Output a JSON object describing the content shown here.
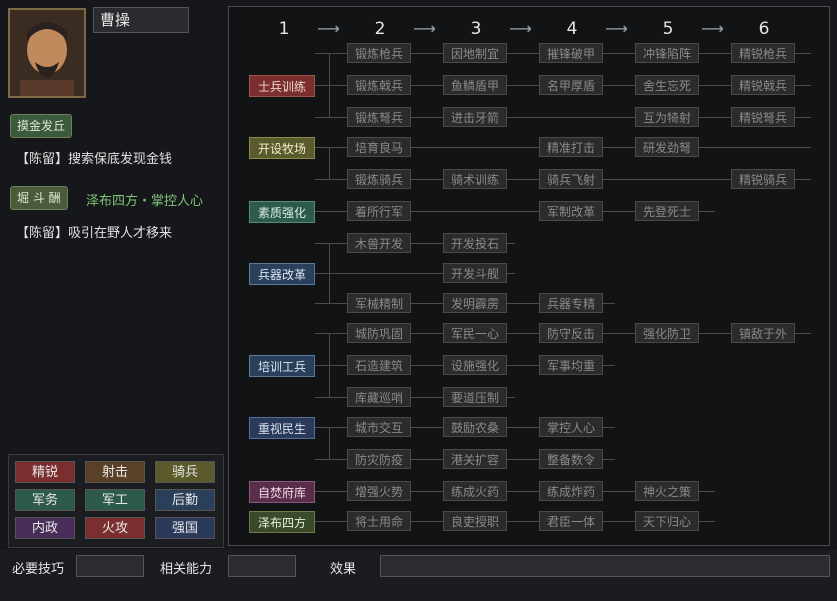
{
  "general": {
    "name": "曹操"
  },
  "left": {
    "tag1": "摸金发丘",
    "note1": "【陈留】搜索保底发现金钱",
    "tag2": "堀 斗 酬",
    "tag2_text": "泽布四方・掌控人心",
    "note2": "【陈留】吸引在野人才移来"
  },
  "categories": [
    {
      "label": "精锐",
      "color": "#7a2e2e"
    },
    {
      "label": "射击",
      "color": "#5a4026"
    },
    {
      "label": "骑兵",
      "color": "#5a5a2a"
    },
    {
      "label": "军务",
      "color": "#2e5a4a"
    },
    {
      "label": "军工",
      "color": "#2e5a4a"
    },
    {
      "label": "后勤",
      "color": "#2a3f5a"
    },
    {
      "label": "内政",
      "color": "#4a2e5a"
    },
    {
      "label": "火攻",
      "color": "#7a2e2e"
    },
    {
      "label": "强国",
      "color": "#2a3a5a"
    }
  ],
  "bottom": {
    "label1": "必要技巧",
    "label2": "相关能力",
    "label3": "效果"
  },
  "tree": {
    "columns": [
      "1",
      "2",
      "3",
      "4",
      "5",
      "6"
    ],
    "cats": [
      {
        "label": "士兵训练",
        "color": "#7a2e2e"
      },
      {
        "label": "开设牧场",
        "color": "#5a5a2a"
      },
      {
        "label": "素质强化",
        "color": "#2e5a4a"
      },
      {
        "label": "兵器改革",
        "color": "#2a3f5a"
      },
      {
        "label": "培训工兵",
        "color": "#2a3f5a"
      },
      {
        "label": "重视民生",
        "color": "#2a3a5a"
      },
      {
        "label": "自焚府库",
        "color": "#5a2e4a"
      },
      {
        "label": "泽布四方",
        "color": "#3b4a2a"
      }
    ],
    "nodes": [
      "锻炼枪兵",
      "因地制宜",
      "摧锋破甲",
      "冲锋陷阵",
      "精锐枪兵",
      "锻炼戟兵",
      "鱼鳞盾甲",
      "名甲厚盾",
      "舍生忘死",
      "精锐戟兵",
      "锻炼弩兵",
      "进击牙箭",
      "互为犄射",
      "精锐弩兵",
      "精准打击",
      "研发劲弩",
      "培育良马",
      "锻炼骑兵",
      "骑术训练",
      "骑兵飞射",
      "精锐骑兵",
      "着所行军",
      "军制改革",
      "先登死士",
      "木兽开发",
      "开发投石",
      "开发斗舰",
      "军械精制",
      "发明霹雳",
      "兵器专精",
      "城防巩固",
      "军民一心",
      "防守反击",
      "强化防卫",
      "镇敌于外",
      "石造建筑",
      "设施强化",
      "军事均重",
      "库藏巡哨",
      "要道压制",
      "城市交互",
      "鼓励农桑",
      "掌控人心",
      "防灾防疫",
      "港关扩容",
      "整备数令",
      "增强火势",
      "练成火药",
      "练成炸药",
      "神火之策",
      "将士用命",
      "良吏授职",
      "君臣一体",
      "天下归心"
    ]
  }
}
